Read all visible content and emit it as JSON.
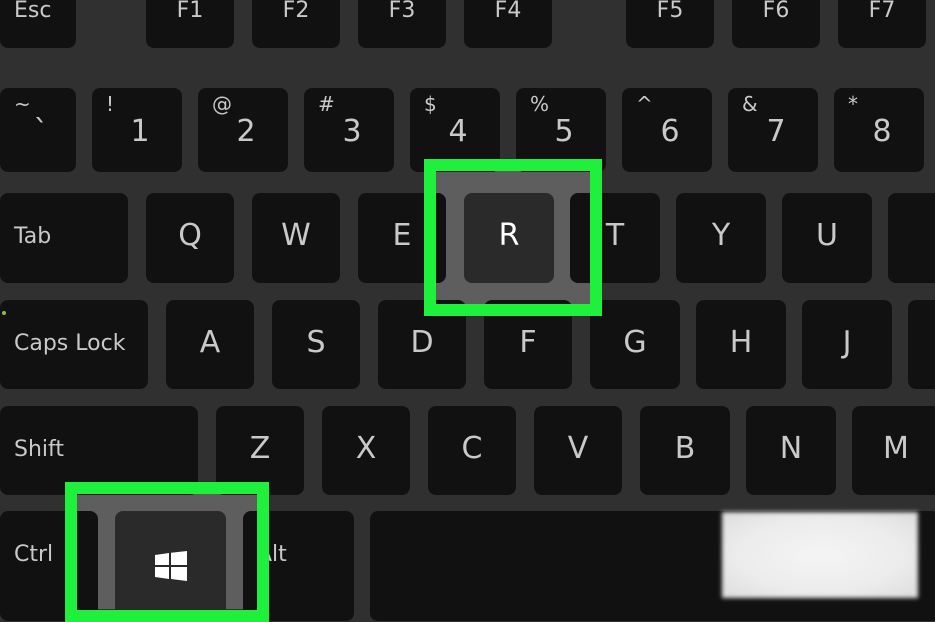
{
  "keyboard": {
    "fn_row": [
      "Esc",
      "F1",
      "F2",
      "F3",
      "F4",
      "F5",
      "F6",
      "F7"
    ],
    "number_row": [
      {
        "top": "~",
        "bottom": "`"
      },
      {
        "top": "!",
        "bottom": "1"
      },
      {
        "top": "@",
        "bottom": "2"
      },
      {
        "top": "#",
        "bottom": "3"
      },
      {
        "top": "$",
        "bottom": "4"
      },
      {
        "top": "%",
        "bottom": "5"
      },
      {
        "top": "^",
        "bottom": "6"
      },
      {
        "top": "&",
        "bottom": "7"
      },
      {
        "top": "*",
        "bottom": "8"
      }
    ],
    "tab_row": [
      "Tab",
      "Q",
      "W",
      "E",
      "R",
      "T",
      "Y",
      "U",
      ""
    ],
    "caps_row": [
      "Caps Lock",
      "A",
      "S",
      "D",
      "F",
      "G",
      "H",
      "J",
      ""
    ],
    "shift_row": [
      "Shift",
      "Z",
      "X",
      "C",
      "V",
      "B",
      "N",
      "M"
    ],
    "bottom_row": [
      "Ctrl",
      "windows-logo-icon",
      "Alt",
      ""
    ],
    "highlighted_keys": [
      "Windows",
      "R"
    ],
    "highlight_color": "#1ff03c",
    "key_color": "#111111",
    "background_color": "#303030"
  }
}
